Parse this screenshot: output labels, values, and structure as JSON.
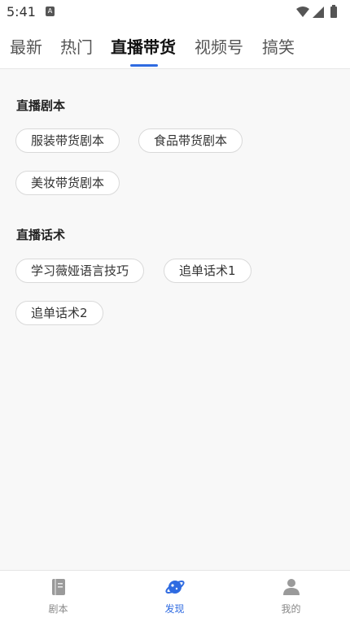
{
  "status_bar": {
    "time": "5:41",
    "notification_glyph": "A"
  },
  "tabs": [
    {
      "label": "最新",
      "active": false
    },
    {
      "label": "热门",
      "active": false
    },
    {
      "label": "直播带货",
      "active": true
    },
    {
      "label": "视频号",
      "active": false
    },
    {
      "label": "搞笑",
      "active": false
    }
  ],
  "sections": [
    {
      "title": "直播剧本",
      "items": [
        "服装带货剧本",
        "食品带货剧本",
        "美妆带货剧本"
      ]
    },
    {
      "title": "直播话术",
      "items": [
        "学习薇娅语言技巧",
        "追单话术1",
        "追单话术2"
      ]
    }
  ],
  "bottom_nav": [
    {
      "label": "剧本",
      "icon": "book-icon",
      "active": false
    },
    {
      "label": "发现",
      "icon": "planet-icon",
      "active": true
    },
    {
      "label": "我的",
      "icon": "user-icon",
      "active": false
    }
  ],
  "colors": {
    "accent": "#2f6be1",
    "inactive": "#888888"
  }
}
